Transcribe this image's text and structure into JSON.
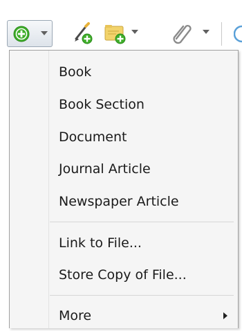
{
  "toolbar": {
    "buttons": [
      {
        "name": "new-item",
        "icon": "plus-circle-icon",
        "has_dropdown": true,
        "pressed": true
      },
      {
        "name": "new-note",
        "icon": "note-add-icon",
        "has_dropdown": false
      },
      {
        "name": "new-collection",
        "icon": "folder-add-icon",
        "has_dropdown": true
      },
      {
        "name": "add-attachment",
        "icon": "paperclip-icon",
        "has_dropdown": true
      }
    ],
    "accent_green": "#3fae2a",
    "attach_icon_color": "#8a8a8a"
  },
  "menu": {
    "items": [
      {
        "label": "Book"
      },
      {
        "label": "Book Section"
      },
      {
        "label": "Document"
      },
      {
        "label": "Journal Article"
      },
      {
        "label": "Newspaper Article"
      },
      {
        "label": "Link to File..."
      },
      {
        "label": "Store Copy of File..."
      },
      {
        "label": "More",
        "has_submenu": true
      }
    ],
    "background": "#f5f5f5",
    "text_color": "#1a1a1a"
  }
}
